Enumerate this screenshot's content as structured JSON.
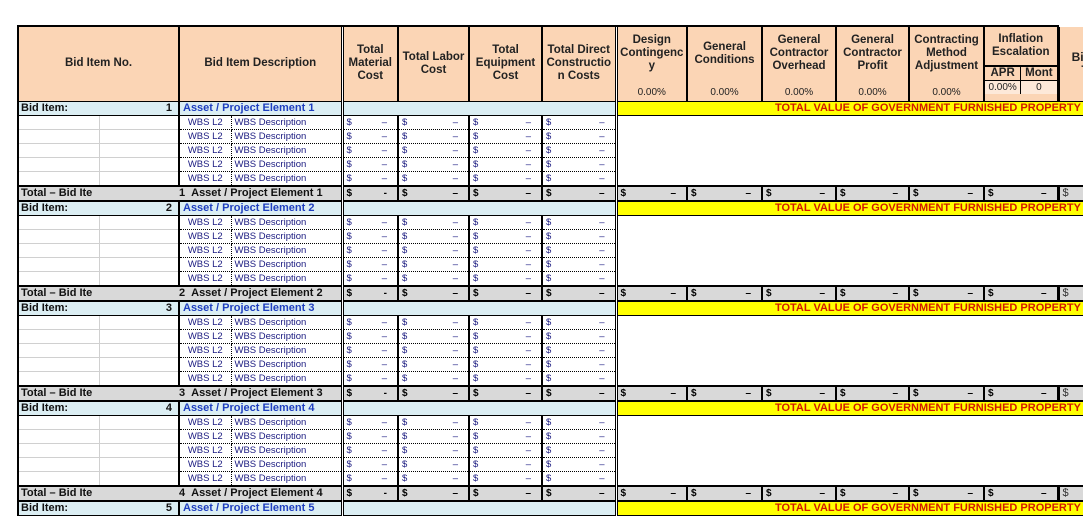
{
  "headers": {
    "bid_item_no": "Bid Item No.",
    "bid_item_description": "Bid Item Description",
    "total_material_cost": "Total Material Cost",
    "total_labor_cost": "Total Labor Cost",
    "total_equipment_cost": "Total Equipment Cost",
    "total_direct_construction_costs": "Total Direct Constructio n Costs",
    "design_contingency": "Design Contingenc y",
    "general_conditions": "General Conditions",
    "gc_overhead": "General Contractor Overhead",
    "gc_profit": "General Contractor Profit",
    "contracting_method_adjustment": "Contracting Method Adjustment",
    "inflation_escalation": "Inflation Escalation",
    "apr": "APR",
    "months": "Mont",
    "bid_item_total": "Bid Item Total"
  },
  "percentages": {
    "design_contingency": "0.00%",
    "general_conditions": "0.00%",
    "gc_overhead": "0.00%",
    "gc_profit": "0.00%",
    "contracting_method_adjustment": "0.00%",
    "apr": "0.00%",
    "months": "0"
  },
  "labels": {
    "bid_item_prefix": "Bid Item:",
    "total_prefix": "Total – Bid Ite",
    "gfp_text": "TOTAL VALUE OF GOVERNMENT FURNISHED PROPERTY (if any):",
    "currency": "$",
    "dash": "–",
    "dot": "-"
  },
  "bid_items": [
    {
      "number": "1",
      "name": "Asset / Project Element 1",
      "total_name": "Asset / Project Element 1",
      "wbs": [
        {
          "code": "WBS L2",
          "desc": "WBS Description"
        },
        {
          "code": "WBS L2",
          "desc": "WBS Description"
        },
        {
          "code": "WBS L2",
          "desc": "WBS Description"
        },
        {
          "code": "WBS L2",
          "desc": "WBS Description"
        },
        {
          "code": "WBS L2",
          "desc": "WBS Description"
        }
      ]
    },
    {
      "number": "2",
      "name": "Asset / Project Element 2",
      "total_name": "Asset / Project Element 2",
      "wbs": [
        {
          "code": "WBS L2",
          "desc": "WBS Description"
        },
        {
          "code": "WBS L2",
          "desc": "WBS Description"
        },
        {
          "code": "WBS L2",
          "desc": "WBS Description"
        },
        {
          "code": "WBS L2",
          "desc": "WBS Description"
        },
        {
          "code": "WBS L2",
          "desc": "WBS Description"
        }
      ]
    },
    {
      "number": "3",
      "name": "Asset / Project Element 3",
      "total_name": "Asset / Project Element 3",
      "wbs": [
        {
          "code": "WBS L2",
          "desc": "WBS Description"
        },
        {
          "code": "WBS L2",
          "desc": "WBS Description"
        },
        {
          "code": "WBS L2",
          "desc": "WBS Description"
        },
        {
          "code": "WBS L2",
          "desc": "WBS Description"
        },
        {
          "code": "WBS L2",
          "desc": "WBS Description"
        }
      ]
    },
    {
      "number": "4",
      "name": "Asset / Project Element 4",
      "total_name": "Asset / Project Element 4",
      "wbs": [
        {
          "code": "WBS L2",
          "desc": "WBS Description"
        },
        {
          "code": "WBS L2",
          "desc": "WBS Description"
        },
        {
          "code": "WBS L2",
          "desc": "WBS Description"
        },
        {
          "code": "WBS L2",
          "desc": "WBS Description"
        },
        {
          "code": "WBS L2",
          "desc": "WBS Description"
        }
      ]
    },
    {
      "number": "5",
      "name": "Asset / Project Element 5",
      "total_name": null,
      "wbs": []
    }
  ]
}
